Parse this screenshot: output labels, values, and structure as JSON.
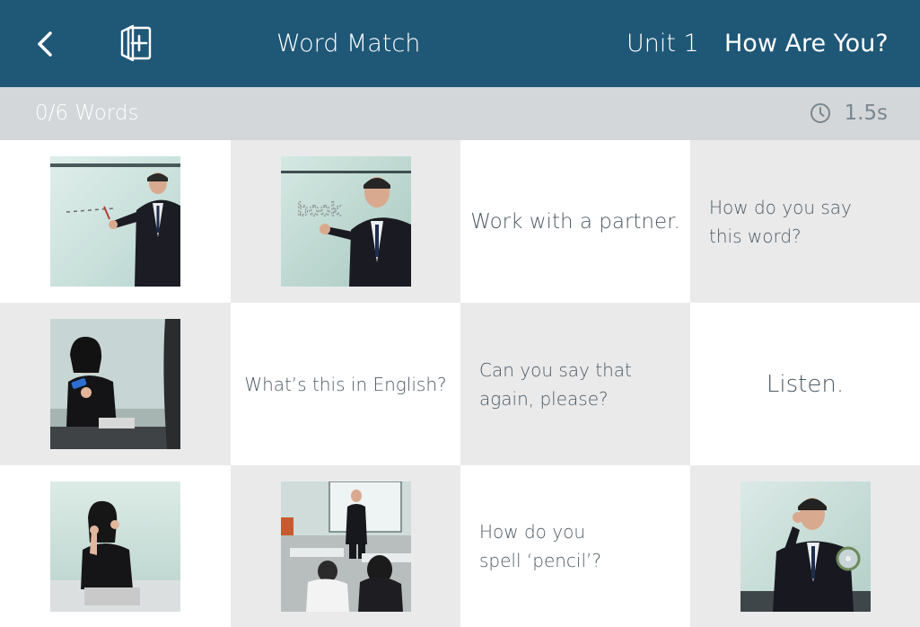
{
  "header": {
    "app_title": "Word Match",
    "unit": "Unit 1",
    "lesson": "How Are You?",
    "back_icon": "chevron-left-icon",
    "add_icon": "add-page-icon",
    "bg_color": "#1f5777"
  },
  "status": {
    "progress": "0/6 Words",
    "timer": "1.5s",
    "timer_icon": "clock-icon"
  },
  "tiles": [
    {
      "type": "image",
      "description_icon": "teacher-pointing-whiteboard-photo"
    },
    {
      "type": "image",
      "description_icon": "teacher-writing-book-photo"
    },
    {
      "type": "text",
      "text": "Work with a partner."
    },
    {
      "type": "text",
      "text": "How do you say this word?"
    },
    {
      "type": "image",
      "description_icon": "student-holding-eraser-photo"
    },
    {
      "type": "text",
      "text": "What’s this in English?"
    },
    {
      "type": "text",
      "text": "Can you say that again, please?"
    },
    {
      "type": "text",
      "text": "Listen."
    },
    {
      "type": "image",
      "description_icon": "student-raising-hand-photo"
    },
    {
      "type": "image",
      "description_icon": "teacher-facing-class-photo"
    },
    {
      "type": "text",
      "text": "How do you spell ‘pencil’?"
    },
    {
      "type": "image",
      "description_icon": "teacher-listening-cd-photo"
    }
  ]
}
